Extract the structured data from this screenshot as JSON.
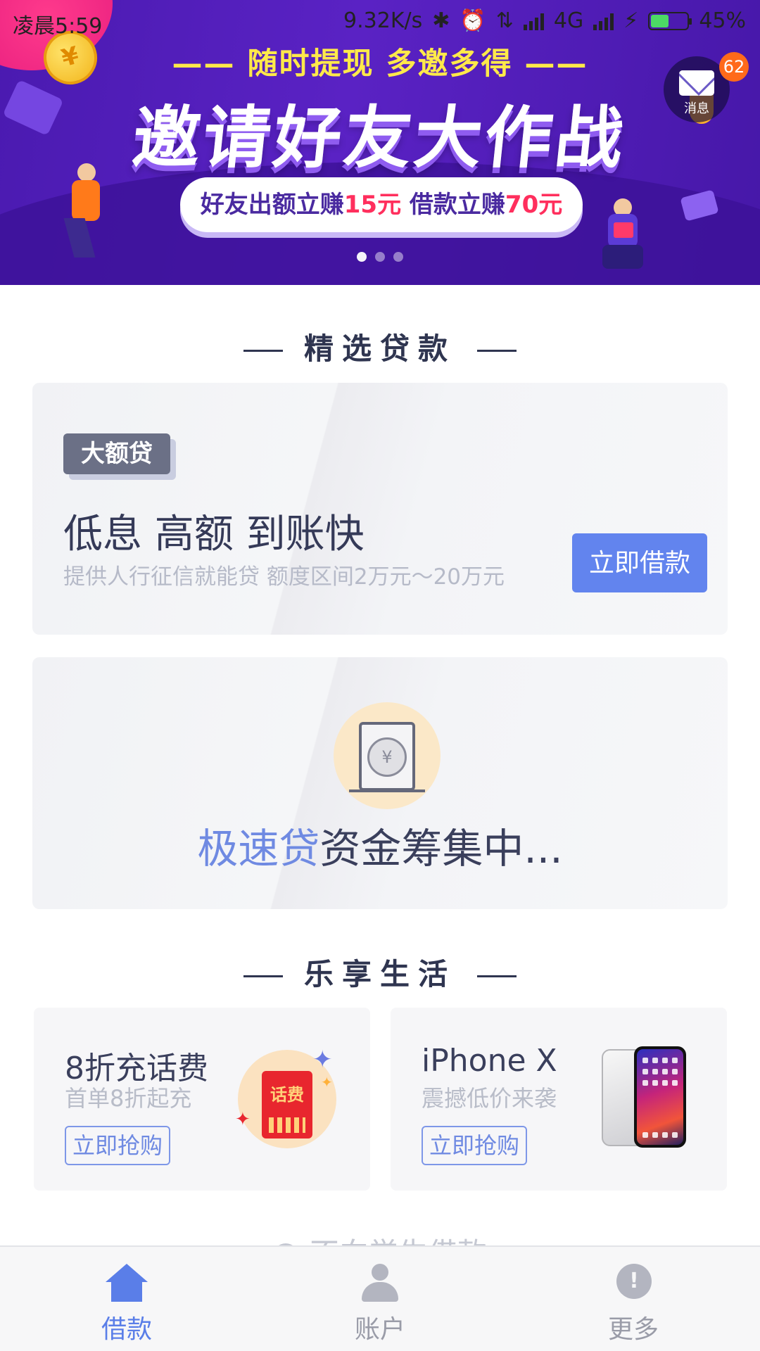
{
  "status_bar": {
    "time": "凌晨5:59",
    "net_speed": "9.32K/s",
    "network": "4G",
    "battery": "45%"
  },
  "banner": {
    "sub_headline": "—— 随时提现 多邀多得 ——",
    "headline": "邀请好友大作战",
    "pill": {
      "part1": "好友出额立赚",
      "amount1": "15元",
      "part2": " 借款立赚",
      "amount2": "70元"
    },
    "page_count": 3,
    "active_page": 1
  },
  "messages": {
    "label": "消息",
    "badge": "62"
  },
  "section_loans": {
    "title": "精选贷款"
  },
  "loan_card": {
    "tag": "大额贷",
    "title": "低息 高额 到账快",
    "subtitle": "提供人行征信就能贷  额度区间2万元～20万元",
    "button": "立即借款"
  },
  "quick_loan": {
    "highlight": "极速贷",
    "text": "资金筹集中..."
  },
  "section_life": {
    "title": "乐享生活"
  },
  "products": [
    {
      "title": "8折充话费",
      "subtitle": "首单8折起充",
      "button": "立即抢购",
      "icon_text": "话费"
    },
    {
      "title": "iPhone X",
      "subtitle": "震撼低价来袭",
      "button": "立即抢购"
    }
  ],
  "faded_text": "不向学生借款",
  "tabs": [
    {
      "label": "借款",
      "icon": "home-icon",
      "active": true
    },
    {
      "label": "账户",
      "icon": "user-icon",
      "active": false
    },
    {
      "label": "更多",
      "icon": "more-icon",
      "active": false
    }
  ],
  "colors": {
    "accent": "#6284ee",
    "banner_bg": "#5a22c4",
    "badge": "#ff6a1a",
    "highlight_red": "#ff2f5d"
  }
}
